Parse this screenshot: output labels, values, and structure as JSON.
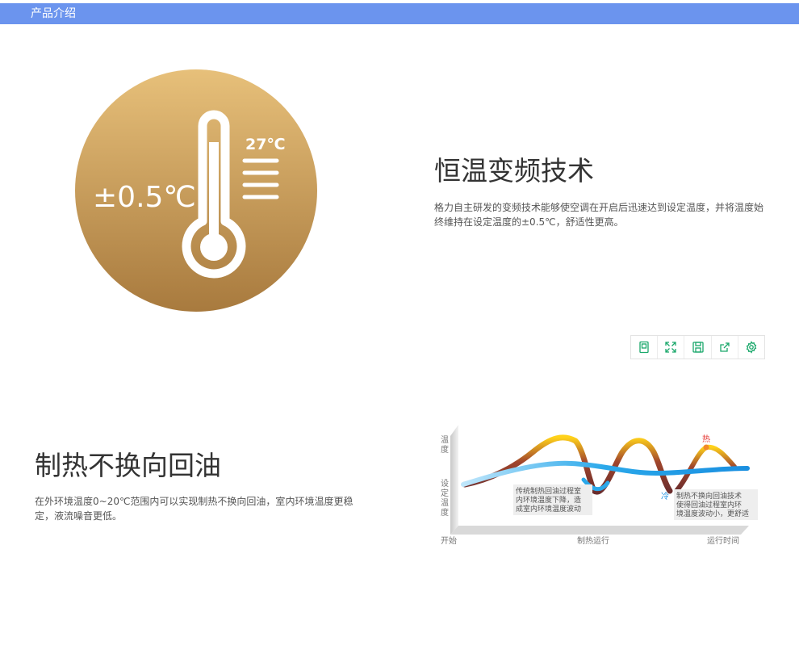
{
  "header": {
    "title": "产品介绍"
  },
  "feature1": {
    "badge_value": "±0.5℃",
    "badge_temp": "27℃",
    "title": "恒温变频技术",
    "description": "格力自主研发的变频技术能够使空调在开启后迅速达到设定温度，并将温度始终维持在设定温度的±0.5℃，舒适性更高。"
  },
  "toolbar": {
    "items": [
      {
        "icon": "save-image-icon"
      },
      {
        "icon": "fullscreen-icon"
      },
      {
        "icon": "save-icon"
      },
      {
        "icon": "share-icon"
      },
      {
        "icon": "settings-icon"
      }
    ]
  },
  "feature2": {
    "title": "制热不换向回油",
    "description": "在外环境温度0~20℃范围内可以实现制热不换向回油，室内环境温度更稳定，液流噪音更低。",
    "diagram": {
      "y_label_top": [
        "温",
        "度"
      ],
      "y_label_set": [
        "设",
        "定",
        "温",
        "度"
      ],
      "x_start": "开始",
      "x_mid": "制热运行",
      "x_end": "运行时间",
      "hot_label": "热",
      "cold_label": "冷",
      "note_left": [
        "传统制热回油过程室",
        "内环境温度下降，造",
        "成室内环境温度波动"
      ],
      "note_right": [
        "制热不换向回油技术",
        "使得回油过程室内环",
        "境温度波动小，更舒适"
      ]
    }
  }
}
